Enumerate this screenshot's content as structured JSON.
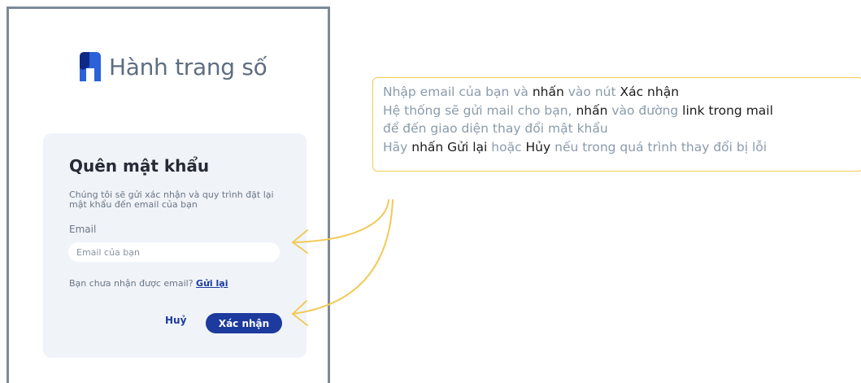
{
  "app": {
    "brand_name": "Hành trang số",
    "brand_color": "#1d3a9e"
  },
  "form": {
    "title": "Quên mật khẩu",
    "description": "Chúng tôi sẽ gửi xác nhận và quy trình đặt lại mật khẩu đến email của bạn",
    "email_label": "Email",
    "email_placeholder": "Email của bạn",
    "email_value": "",
    "resend_prompt": "Bạn chưa nhận được email?",
    "resend_link": "Gửi lại",
    "cancel_label": "Huỷ",
    "confirm_label": "Xác nhận"
  },
  "annotation": {
    "border_color": "#f2ca58",
    "lines": [
      [
        {
          "text": "Nhập email của bạn và ",
          "hl": false
        },
        {
          "text": "nhấn",
          "hl": true
        },
        {
          "text": " vào nút ",
          "hl": false
        },
        {
          "text": "Xác nhận",
          "hl": true
        }
      ],
      [
        {
          "text": "Hệ thống sẽ gửi mail cho bạn, ",
          "hl": false
        },
        {
          "text": "nhấn",
          "hl": true
        },
        {
          "text": " vào đường ",
          "hl": false
        },
        {
          "text": "link trong mail",
          "hl": true
        }
      ],
      [
        {
          "text": "để đến giao diện thay đổi mật khẩu",
          "hl": false
        }
      ],
      [
        {
          "text": "Hãy ",
          "hl": false
        },
        {
          "text": "nhấn Gửi lại",
          "hl": true
        },
        {
          "text": " hoặc ",
          "hl": false
        },
        {
          "text": "Hủy",
          "hl": true
        },
        {
          "text": " nếu trong quá trình thay đổi bị lỗi",
          "hl": false
        }
      ]
    ]
  }
}
